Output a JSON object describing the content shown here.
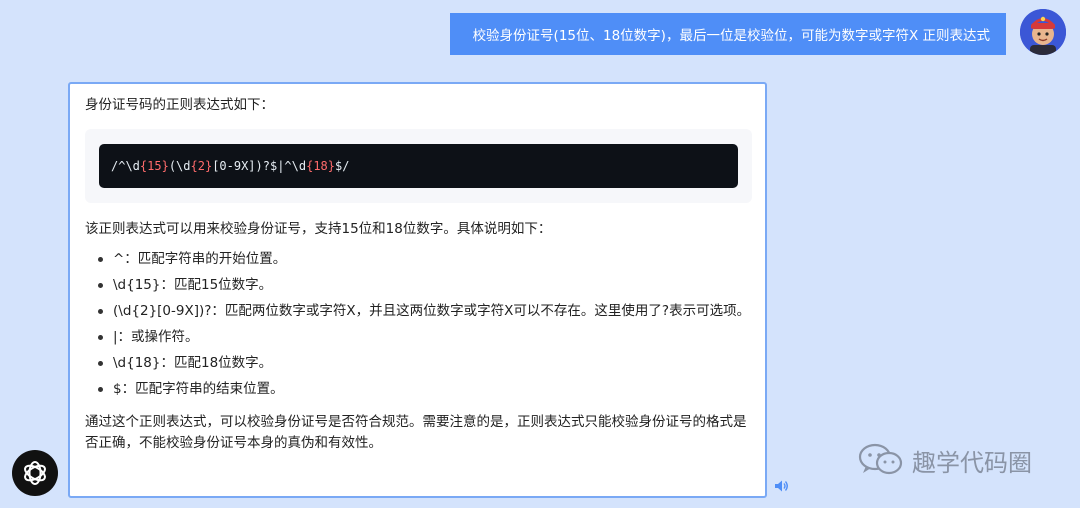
{
  "user_message": "校验身份证号(15位、18位数字)，最后一位是校验位，可能为数字或字符X 正则表达式",
  "assistant": {
    "intro": "身份证号码的正则表达式如下：",
    "code": {
      "p1": "/^\\d",
      "n1": "{15}",
      "p2": "(\\d",
      "n2": "{2}",
      "p3": "[0-9X])?$|^\\d",
      "n3": "{18}",
      "p4": "$/"
    },
    "description": "该正则表达式可以用来校验身份证号，支持15位和18位数字。具体说明如下：",
    "points": [
      "^：匹配字符串的开始位置。",
      "\\d{15}：匹配15位数字。",
      "(\\d{2}[0-9X])?：匹配两位数字或字符X，并且这两位数字或字符X可以不存在。这里使用了?表示可选项。",
      "|：或操作符。",
      "\\d{18}：匹配18位数字。",
      "$：匹配字符串的结束位置。"
    ],
    "summary": "通过这个正则表达式，可以校验身份证号是否符合规范。需要注意的是，正则表达式只能校验身份证号的格式是否正确，不能校验身份证号本身的真伪和有效性。"
  },
  "watermark": "趣学代码圈",
  "icons": {
    "user_avatar": "user-avatar",
    "assistant_logo": "openai-logo-icon",
    "speaker": "speaker-icon",
    "wechat": "wechat-icon"
  },
  "colors": {
    "background": "#d4e3fc",
    "user_bubble": "#4f8ef7",
    "card_border": "#7aa9f5",
    "code_bg": "#0d1117",
    "code_number": "#ff6b6b"
  }
}
